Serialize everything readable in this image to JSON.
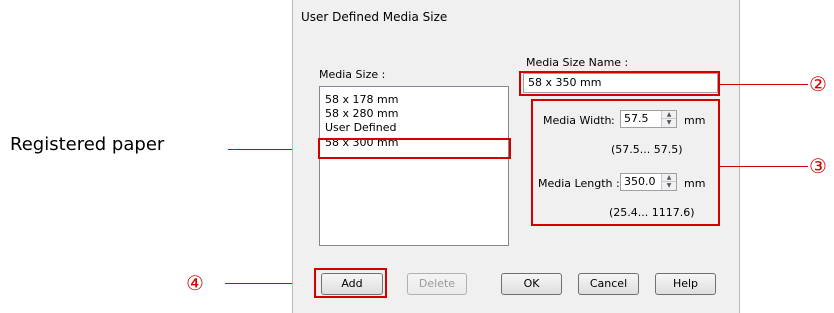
{
  "annotation": {
    "registered_paper": "Registered paper",
    "marker_2": "②",
    "marker_3": "③",
    "marker_4": "④"
  },
  "dialog": {
    "title": "User Defined Media Size",
    "media_size_label": "Media Size :",
    "media_size_items": [
      "58 x 178 mm",
      "58 x 280 mm",
      "User Defined",
      "58 x 300 mm"
    ],
    "media_size_name_label": "Media Size Name :",
    "media_size_name_value": "58 x 350 mm",
    "media_width_label": "Media Width",
    "media_width_colon": ":",
    "media_width_value": "57.5",
    "media_width_unit": "mm",
    "media_width_range": "(57.5... 57.5)",
    "media_length_label": "Media Length :",
    "media_length_value": "350.0",
    "media_length_unit": "mm",
    "media_length_range": "(25.4... 1117.6)",
    "buttons": {
      "add": "Add",
      "delete": "Delete",
      "ok": "OK",
      "cancel": "Cancel",
      "help": "Help"
    }
  },
  "colors": {
    "annotation_red": "#d40000",
    "dialog_bg": "#f0f0f0"
  }
}
